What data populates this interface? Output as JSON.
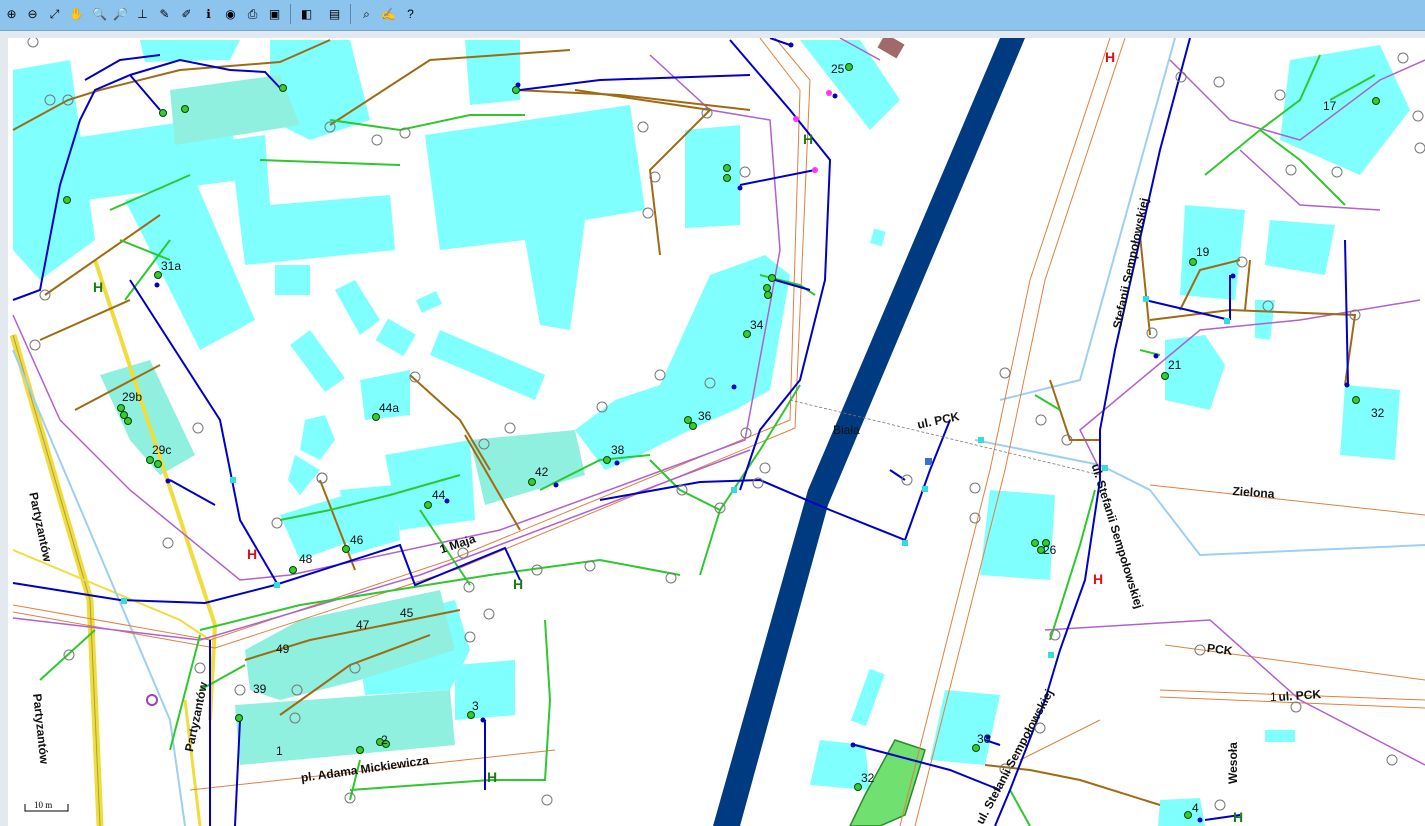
{
  "toolbar": {
    "tools": [
      {
        "name": "zoom-in-tool-icon",
        "glyph": "⊕"
      },
      {
        "name": "zoom-out-tool-icon",
        "glyph": "⊖"
      },
      {
        "name": "full-extent-icon",
        "glyph": "⤢"
      },
      {
        "name": "pan-hand-icon",
        "glyph": "✋"
      },
      {
        "name": "zoom-in-button-icon",
        "glyph": "🔍"
      },
      {
        "name": "zoom-out-button-icon",
        "glyph": "🔎"
      },
      {
        "name": "measure-distance-icon",
        "glyph": "⊥"
      },
      {
        "name": "measure-area-icon",
        "glyph": "✎"
      },
      {
        "name": "measure-tool-icon",
        "glyph": "✐"
      },
      {
        "name": "info-icon",
        "glyph": "ℹ"
      },
      {
        "name": "globe-icon",
        "glyph": "◉"
      },
      {
        "name": "print-icon",
        "glyph": "⎙"
      },
      {
        "name": "export-icon",
        "glyph": "▣"
      },
      {
        "name": "layers-icon",
        "glyph": "◧"
      },
      {
        "name": "toolbox-icon",
        "glyph": "▤"
      },
      {
        "name": "search-address-icon",
        "glyph": "⌕"
      },
      {
        "name": "edit-icon",
        "glyph": "✍"
      },
      {
        "name": "help-icon",
        "glyph": "?"
      }
    ]
  },
  "map": {
    "building_numbers": [
      "25",
      "17",
      "31a",
      "19",
      "34",
      "21",
      "29b",
      "32",
      "44a",
      "36",
      "29c",
      "38",
      "42",
      "44",
      "46",
      "26",
      "48",
      "45",
      "47",
      "49",
      "3",
      "39",
      "30",
      "2",
      "1",
      "32",
      "4",
      "1"
    ],
    "street_labels": {
      "pck": "ul. PCK",
      "biala": "Biała",
      "zielona": "Zielona",
      "sempolowskiej_north": "Stefanii Sempołowskiej",
      "sempolowskiej_mid": "ul. Stefanii Sempołowskiej",
      "sempolowskiej_south": "ul. Stefanii Sempołowskiej",
      "partyzantow_1": "Partyzantów",
      "partyzantow_2": "Partyzantów",
      "partyzantow_3": "Partyzantów",
      "maja": "1 Maja",
      "mickiewicza": "pl. Adama Mickiewicza",
      "pck_short": "PCK",
      "pck_east": "ul. PCK",
      "wesola": "Wesoła"
    },
    "scale_bar": "10 m",
    "colors": {
      "building": "#80ffff",
      "building_alt": "#90f0e0",
      "river": "#003a80",
      "water_pipe": "#0000c8",
      "gas_pipe": "#2ec82e",
      "sewer_pipe": "#a06a10",
      "telecom": "#b060d0",
      "road_yellow": "#f0dc3c",
      "light_blue": "#9fcff0",
      "hydrant": "#e01010"
    }
  }
}
